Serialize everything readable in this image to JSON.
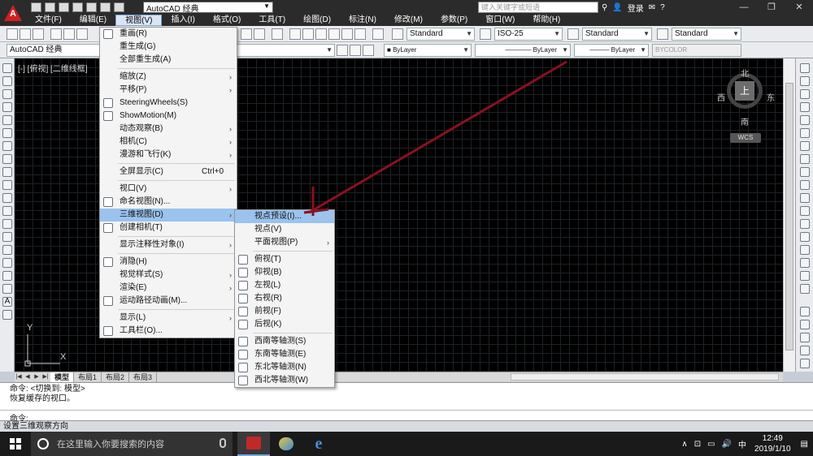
{
  "app": {
    "logo_text": "A",
    "workspace": "AutoCAD 经典",
    "search_placeholder": "键入关键字或短语",
    "login": "登录",
    "help": "?"
  },
  "window": {
    "minimize": "—",
    "restore": "❐",
    "close": "✕"
  },
  "menubar": [
    "文件(F)",
    "编辑(E)",
    "视图(V)",
    "插入(I)",
    "格式(O)",
    "工具(T)",
    "绘图(D)",
    "标注(N)",
    "修改(M)",
    "参数(P)",
    "窗口(W)",
    "帮助(H)"
  ],
  "toolbar1": {
    "text_style": "Standard",
    "dim_style": "ISO-25",
    "table_style": "Standard",
    "mleader_style": "Standard"
  },
  "toolbar2": {
    "workspace": "AutoCAD 经典",
    "color": "ByLayer",
    "linetype": "ByLayer",
    "lineweight": "ByLayer",
    "plotstyle": "BYCOLOR"
  },
  "viewport": {
    "label": "[-] [俯视] [二维线框]"
  },
  "viewcube": {
    "north": "北",
    "south": "南",
    "east": "东",
    "west": "西",
    "face": "上",
    "wcs": "WCS"
  },
  "ucs": {
    "x": "X",
    "y": "Y"
  },
  "layout_tabs": {
    "nav": [
      "|◀",
      "◀",
      "▶",
      "▶|"
    ],
    "tabs": [
      "模型",
      "布局1",
      "布局2",
      "布局3"
    ],
    "active": "模型"
  },
  "command": {
    "history": [
      "命令:  <切换到: 模型>",
      "恢复缓存的视口。"
    ],
    "prompt": "命令:"
  },
  "status": "设置三维观察方向",
  "view_menu": [
    {
      "label": "重画(R)",
      "icon": "redraw-icon"
    },
    {
      "label": "重生成(G)"
    },
    {
      "label": "全部重生成(A)"
    },
    {
      "sep": true
    },
    {
      "label": "缩放(Z)",
      "sub": true
    },
    {
      "label": "平移(P)",
      "sub": true
    },
    {
      "label": "SteeringWheels(S)",
      "icon": "steering-wheel-icon"
    },
    {
      "label": "ShowMotion(M)",
      "icon": "showmotion-icon"
    },
    {
      "label": "动态观察(B)",
      "sub": true
    },
    {
      "label": "相机(C)",
      "sub": true
    },
    {
      "label": "漫游和飞行(K)",
      "sub": true
    },
    {
      "sep": true
    },
    {
      "label": "全屏显示(C)",
      "shortcut": "Ctrl+0"
    },
    {
      "sep": true
    },
    {
      "label": "视口(V)",
      "sub": true
    },
    {
      "label": "命名视图(N)...",
      "icon": "named-view-icon"
    },
    {
      "label": "三维视图(D)",
      "sub": true,
      "highlight": true
    },
    {
      "label": "创建相机(T)",
      "icon": "camera-icon"
    },
    {
      "sep": true
    },
    {
      "label": "显示注释性对象(I)",
      "sub": true
    },
    {
      "sep": true
    },
    {
      "label": "消隐(H)",
      "icon": "hide-icon"
    },
    {
      "label": "视觉样式(S)",
      "sub": true
    },
    {
      "label": "渲染(E)",
      "sub": true
    },
    {
      "label": "运动路径动画(M)...",
      "icon": "motion-path-icon"
    },
    {
      "sep": true
    },
    {
      "label": "显示(L)",
      "sub": true
    },
    {
      "label": "工具栏(O)...",
      "icon": "toolbar-icon"
    }
  ],
  "view3d_submenu": [
    {
      "label": "视点预设(I)...",
      "highlight": true
    },
    {
      "label": "视点(V)"
    },
    {
      "label": "平面视图(P)",
      "sub": true
    },
    {
      "sep": true
    },
    {
      "label": "俯视(T)",
      "icon": "top-view-icon"
    },
    {
      "label": "仰视(B)",
      "icon": "bottom-view-icon"
    },
    {
      "label": "左视(L)",
      "icon": "left-view-icon"
    },
    {
      "label": "右视(R)",
      "icon": "right-view-icon"
    },
    {
      "label": "前视(F)",
      "icon": "front-view-icon"
    },
    {
      "label": "后视(K)",
      "icon": "back-view-icon"
    },
    {
      "sep": true
    },
    {
      "label": "西南等轴测(S)",
      "icon": "sw-iso-icon"
    },
    {
      "label": "东南等轴测(E)",
      "icon": "se-iso-icon"
    },
    {
      "label": "东北等轴测(N)",
      "icon": "ne-iso-icon"
    },
    {
      "label": "西北等轴测(W)",
      "icon": "nw-iso-icon"
    }
  ],
  "taskbar": {
    "search_placeholder": "在这里输入你要搜索的内容",
    "time": "12:49",
    "date": "2019/1/10",
    "ime": "中"
  },
  "colors": {
    "accent_highlight": "#9ac3ee",
    "annotation_arrow": "#8b1020"
  }
}
